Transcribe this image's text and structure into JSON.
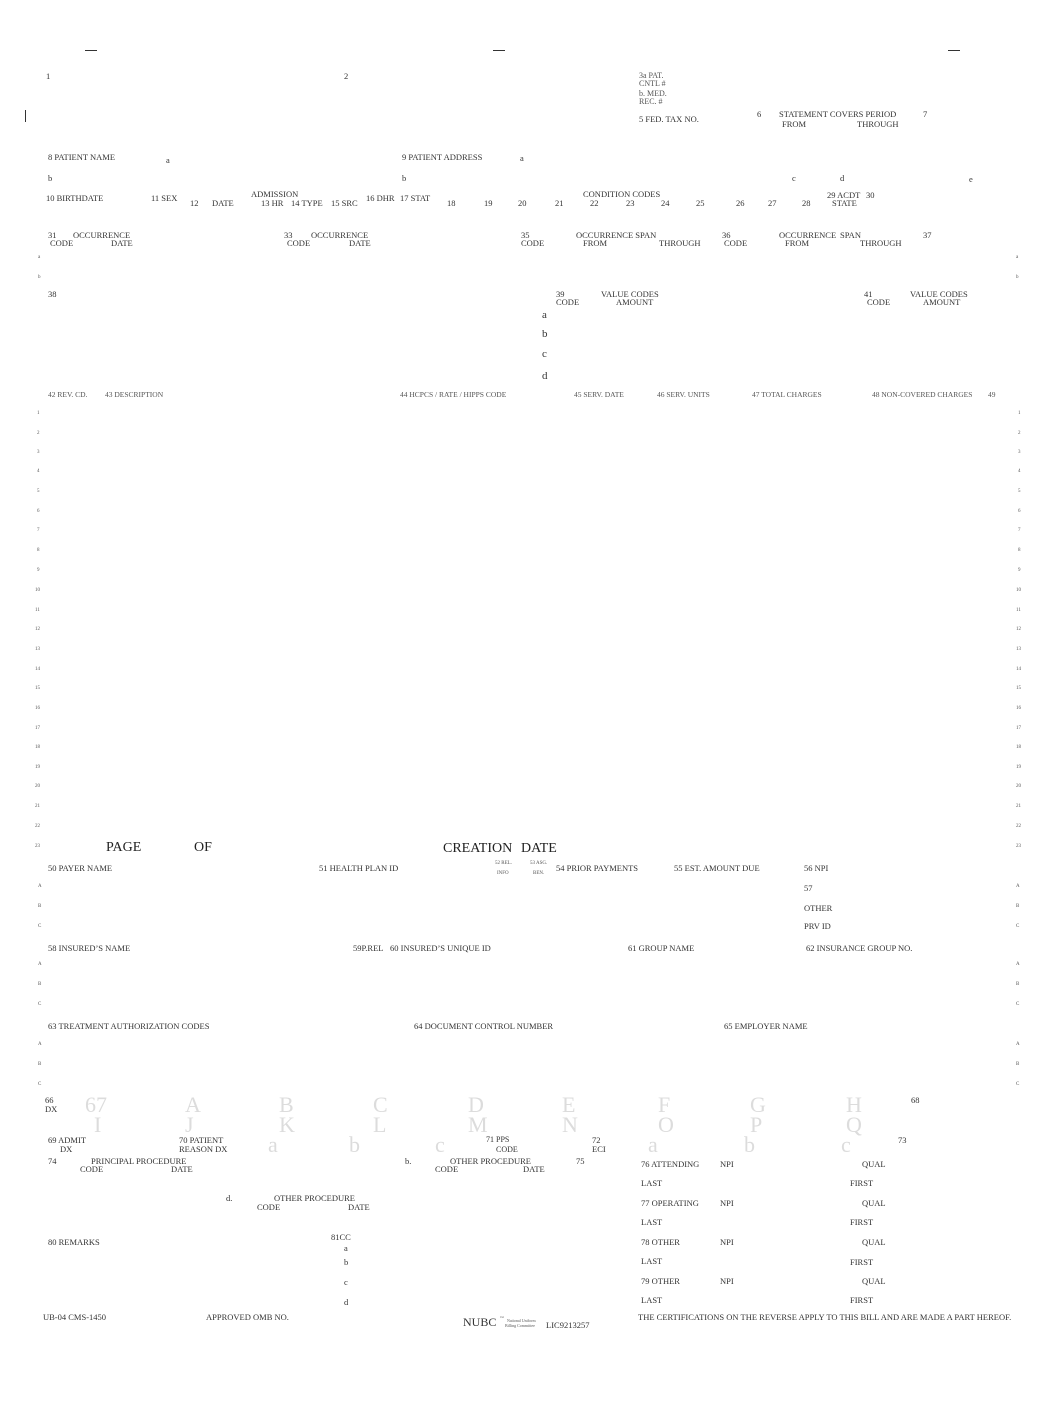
{
  "form": {
    "name": "UB-04 CMS-1450",
    "approved": "APPROVED OMB NO.",
    "nubc": "NUBC",
    "nubc_tm": "™",
    "nubc_sub1": "National Uniform",
    "nubc_sub2": "Billing Committee",
    "license": "LIC9213257",
    "certification": "THE CERTIFICATIONS ON THE REVERSE APPLY TO THIS BILL AND ARE MADE A PART HEREOF."
  },
  "header": {
    "f1": "1",
    "f2": "2",
    "f3a_1": "3a PAT.",
    "f3a_2": "CNTL #",
    "f3b_1": "b. MED.",
    "f3b_2": "REC. #",
    "f5": "5 FED. TAX NO.",
    "f6": "6",
    "f6_title": "STATEMENT COVERS PERIOD",
    "f6_from": "FROM",
    "f6_through": "THROUGH",
    "f7": "7"
  },
  "patient": {
    "f8": "8 PATIENT NAME",
    "f8a": "a",
    "f8b": "b",
    "f9": "9 PATIENT ADDRESS",
    "f9a": "a",
    "f9b": "b",
    "f9c": "c",
    "f9d": "d",
    "f9e": "e",
    "f10": "10 BIRTHDATE",
    "f11": "11 SEX",
    "admission": "ADMISSION",
    "f12": "12",
    "f12_date": "DATE",
    "f13": "13 HR",
    "f14": "14 TYPE",
    "f15": "15 SRC",
    "f16": "16  DHR",
    "f17": "17  STAT",
    "condition_codes": "CONDITION CODES",
    "cc_numbers": [
      "18",
      "19",
      "20",
      "21",
      "22",
      "23",
      "24",
      "25",
      "26",
      "27",
      "28"
    ],
    "f29": "29  ACDT",
    "f29_state": "STATE",
    "f30": "30"
  },
  "occurrence": {
    "f31": "31",
    "f33": "33",
    "occ": "OCCURRENCE",
    "code": "CODE",
    "date": "DATE",
    "f35": "35",
    "f35_code": "CODE",
    "f35_title": "OCCURRENCE SPAN",
    "f35_from": "FROM",
    "f35_through": "THROUGH",
    "f36": "36",
    "f36_code": "CODE",
    "f36_title": "OCCURRENCE",
    "f36_span": "SPAN",
    "f36_from": "FROM",
    "f36_through": "THROUGH",
    "f37": "37",
    "row_a": "a",
    "row_b": "b"
  },
  "values": {
    "f38": "38",
    "f39": "39",
    "f39_code": "CODE",
    "f39_title": "VALUE CODES",
    "f39_amount": "AMOUNT",
    "f41": "41",
    "f41_code": "CODE",
    "f41_title": "VALUE CODES",
    "f41_amount": "AMOUNT",
    "rows": [
      "a",
      "b",
      "c",
      "d"
    ]
  },
  "service_lines": {
    "headers": {
      "f42": "42 REV. CD.",
      "f43": "43 DESCRIPTION",
      "f44": "44 HCPCS  /  RATE  /  HIPPS   CODE",
      "f45": "45 SERV. DATE",
      "f46": "46 SERV. UNITS",
      "f47": "47 TOTAL  CHARGES",
      "f48": "48 NON-COVERED CHARGES",
      "f49": "49"
    },
    "line_numbers": [
      "1",
      "2",
      "3",
      "4",
      "5",
      "6",
      "7",
      "8",
      "9",
      "10",
      "11",
      "12",
      "13",
      "14",
      "15",
      "16",
      "17",
      "18",
      "19",
      "20",
      "21",
      "22",
      "23"
    ],
    "page": "PAGE",
    "of": "OF",
    "creation": "CREATION",
    "date": "DATE"
  },
  "payer": {
    "f50": "50 PAYER NAME",
    "f51": "51 HEALTH PLAN ID",
    "f52_1": "52 REL.",
    "f52_2": "INFO",
    "f53_1": "53 ASG.",
    "f53_2": "BEN.",
    "f54": "54 PRIOR PAYMENTS",
    "f55": "55 EST. AMOUNT DUE",
    "f56": "56 NPI",
    "f57": "57",
    "f57_other": "OTHER",
    "f57_prv": "PRV ID",
    "rows": [
      "A",
      "B",
      "C"
    ]
  },
  "insured": {
    "f58": "58 INSURED’S NAME",
    "f59": "59P.REL",
    "f60": "60 INSURED’S UNIQUE ID",
    "f61": "61 GROUP NAME",
    "f62": "62 INSURANCE GROUP NO.",
    "rows": [
      "A",
      "B",
      "C"
    ]
  },
  "auth": {
    "f63": "63 TREATMENT AUTHORIZATION CODES",
    "f64": "64 DOCUMENT CONTROL NUMBER",
    "f65": "65 EMPLOYER NAME",
    "rows": [
      "A",
      "B",
      "C"
    ]
  },
  "diagnosis": {
    "f66": "66",
    "f66_dx": "DX",
    "f67": "67",
    "row1": [
      "A",
      "B",
      "C",
      "D",
      "E",
      "F",
      "G",
      "H"
    ],
    "row2": [
      "I",
      "J",
      "K",
      "L",
      "M",
      "N",
      "O",
      "P",
      "Q"
    ],
    "f68": "68",
    "f69_1": "69 ADMIT",
    "f69_2": "DX",
    "f70_1": "70 PATIENT",
    "f70_2": "REASON DX",
    "f70_abc": [
      "a",
      "b",
      "c"
    ],
    "f71_1": "71 PPS",
    "f71_2": "CODE",
    "f72_1": "72",
    "f72_2": "ECI",
    "f72_abc": [
      "a",
      "b",
      "c"
    ],
    "f73": "73"
  },
  "procedures": {
    "f74": "74",
    "principal": "PRINCIPAL PROCEDURE",
    "code": "CODE",
    "date": "DATE",
    "b": "b.",
    "other": "OTHER PROCEDURE",
    "d": "d.",
    "f75": "75"
  },
  "physicians": {
    "f76": "76  ATTENDING",
    "f77": "77  OPERATING",
    "f78": "78  OTHER",
    "f79": "79  OTHER",
    "npi": "NPI",
    "qual": "QUAL",
    "last": "LAST",
    "first": "FIRST"
  },
  "remarks": {
    "f80": "80 REMARKS",
    "f81": "81CC",
    "rows": [
      "a",
      "b",
      "c",
      "d"
    ]
  }
}
